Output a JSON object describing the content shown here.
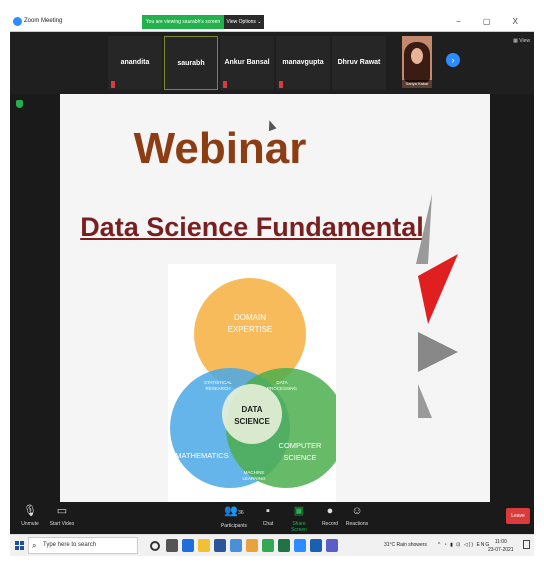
{
  "window": {
    "app_title": "Zoom Meeting",
    "viewing_banner": "You are viewing saurabh's screen",
    "view_options": "View Options ⌄",
    "controls": "− ▢ X",
    "strip_view": "▦ View"
  },
  "participants": [
    {
      "name": "anandita",
      "muted": true
    },
    {
      "name": "saurabh",
      "muted": false,
      "active": true
    },
    {
      "name": "Ankur Bansal",
      "muted": true
    },
    {
      "name": "manavgupta",
      "muted": true
    },
    {
      "name": "Dhruv Rawat",
      "muted": false
    },
    {
      "name": "Sanya Kakar",
      "video": true
    }
  ],
  "slide": {
    "title": "Webinar",
    "subtitle": "Data Science Fundamental",
    "venn": {
      "domain": [
        "DOMAIN",
        "EXPERTISE"
      ],
      "math": "MATHEMATICS",
      "cs": [
        "COMPUTER",
        "SCIENCE"
      ],
      "center": [
        "DATA",
        "SCIENCE"
      ],
      "stat": [
        "STATISTICAL",
        "RESEARCH"
      ],
      "dp": [
        "DATA",
        "PROCESSING"
      ],
      "ml": [
        "MACHINE",
        "LEARNING"
      ],
      "colors": {
        "domain": "#f6b44a",
        "math": "#4aa8e6",
        "cs": "#4cae4c",
        "center": "#e8f0d8"
      }
    }
  },
  "toolbar": {
    "unmute": "Unmute",
    "start_video": "Start Video",
    "participants": "Participants",
    "participants_count": "36",
    "chat": "Chat",
    "share_screen": "Share Screen",
    "record": "Record",
    "reactions": "Reactions",
    "leave": "Leave"
  },
  "taskbar": {
    "search_placeholder": "Type here to search",
    "weather": "31°C Rain showers",
    "lang": "ENG",
    "time": "11:00",
    "date": "23-07-2021"
  }
}
